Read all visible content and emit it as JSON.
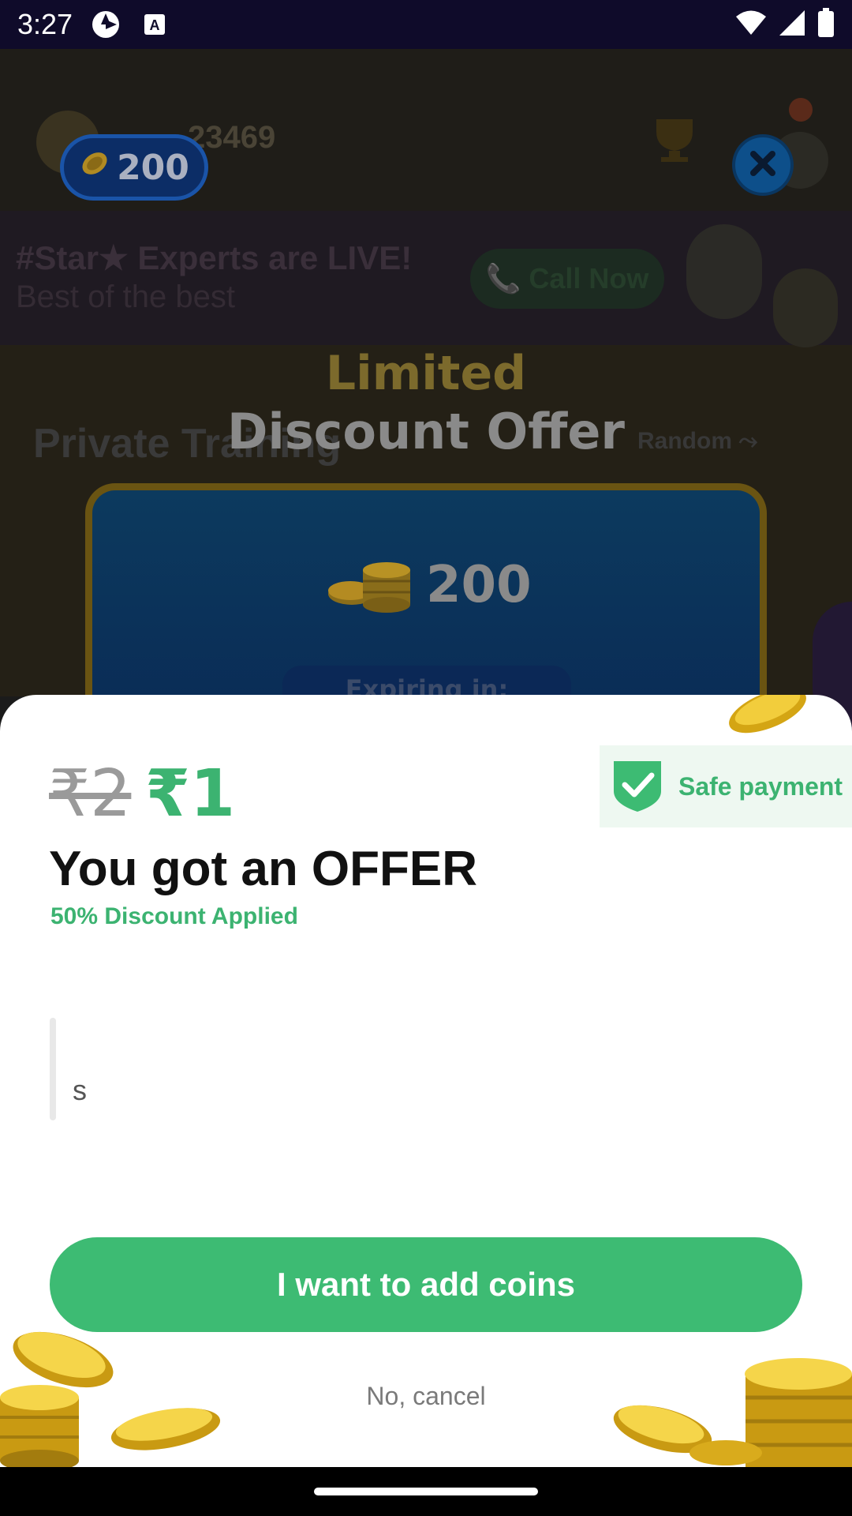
{
  "status_bar": {
    "time": "3:27",
    "icons": [
      "app-shutter-icon",
      "keyboard-a-icon",
      "wifi-icon",
      "cellular-signal-icon",
      "battery-icon"
    ]
  },
  "background": {
    "score": "23469",
    "banner_title": "#Star★ Experts are LIVE!",
    "banner_subtitle": "Best of the best",
    "call_button": "📞 Call Now",
    "section_title": "Private Training",
    "random_link": "Random ⤳"
  },
  "promo": {
    "coin_balance": "200",
    "title_line1": "Limited",
    "title_line2": "Discount Offer",
    "card_coins": "200",
    "expiring_label": "Expiring in:"
  },
  "sheet": {
    "price_old": "₹2",
    "price_new": "₹1",
    "safe_payment_label": "Safe payment",
    "headline": "You got an OFFER",
    "discount_text": "50% Discount Applied",
    "quote_text": "s",
    "cta_label": "I want to add coins",
    "cancel_label": "No, cancel"
  },
  "colors": {
    "accent_green": "#3dbb73",
    "status_bar_bg": "#0f0b2a",
    "coin_gold": "#d4a514"
  }
}
